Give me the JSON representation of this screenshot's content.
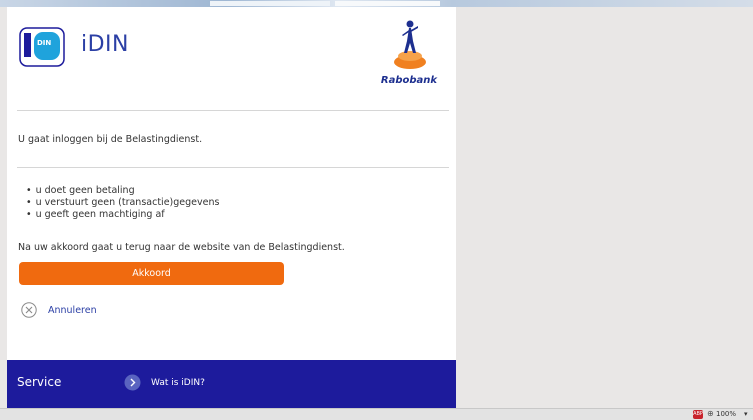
{
  "header": {
    "brand": "iDIN",
    "bank_name": "Rabobank"
  },
  "content": {
    "intro": "U gaat inloggen bij de Belastingdienst.",
    "bullets": [
      "u doet geen betaling",
      "u verstuurt geen (transactie)gegevens",
      "u geeft geen machtiging af"
    ],
    "after": "Na uw akkoord gaat u terug naar de website van de Belastingdienst."
  },
  "actions": {
    "agree_label": "Akkoord",
    "cancel_label": "Annuleren"
  },
  "service": {
    "title": "Service",
    "link_label": "Wat is iDIN?"
  },
  "statusbar": {
    "addon_badge": "ABP",
    "zoom": "100%"
  },
  "colors": {
    "accent_orange": "#f06a0f",
    "brand_blue": "#2b3fa5",
    "service_bar": "#1d1b9c"
  },
  "icons": [
    "idin-logo-icon",
    "rabobank-logo-icon",
    "close-circle-icon",
    "chevron-right-circle-icon",
    "zoom-icon"
  ]
}
